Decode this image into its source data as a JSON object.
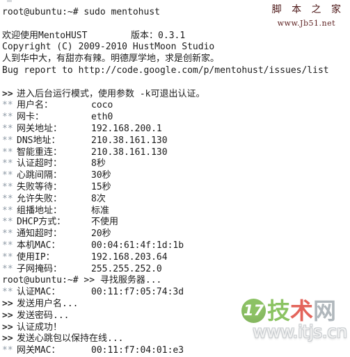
{
  "terminal": {
    "background_color": "#ffffff",
    "text_color": "#1a1a1a",
    "marker_color": "#8e9aa6",
    "lines": [
      {
        "type": "prompt",
        "text": "root@ubuntu:~# sudo mentohust"
      },
      {
        "type": "blank",
        "text": ""
      },
      {
        "type": "plain",
        "text": "欢迎使用MentoHUST        版本：0.3.1"
      },
      {
        "type": "plain",
        "text": "Copyright (C) 2009-2010 HustMoon Studio"
      },
      {
        "type": "plain",
        "text": "人到华中大，有甜亦有辣。明德厚学地，求是创新家。"
      },
      {
        "type": "plain",
        "text": "Bug report to http://code.google.com/p/mentohust/issues/list"
      },
      {
        "type": "blank",
        "text": ""
      },
      {
        "type": "arrow",
        "prefix": ">>",
        "text": "进入后台运行模式，使用参数 -k可退出认证。"
      },
      {
        "type": "kv",
        "prefix": "**",
        "label": "用户名：",
        "value": "coco"
      },
      {
        "type": "kv",
        "prefix": "**",
        "label": "网卡：",
        "value": "eth0"
      },
      {
        "type": "kv",
        "prefix": "**",
        "label": "网关地址：",
        "value": "192.168.200.1"
      },
      {
        "type": "kv",
        "prefix": "**",
        "label": "DNS地址：",
        "value": "210.38.161.130"
      },
      {
        "type": "kv",
        "prefix": "**",
        "label": "智能重连：",
        "value": "210.38.161.130"
      },
      {
        "type": "kv",
        "prefix": "**",
        "label": "认证超时：",
        "value": "8秒"
      },
      {
        "type": "kv",
        "prefix": "**",
        "label": "心跳间隔：",
        "value": "30秒"
      },
      {
        "type": "kv",
        "prefix": "**",
        "label": "失败等待：",
        "value": "15秒"
      },
      {
        "type": "kv",
        "prefix": "**",
        "label": "允许失败：",
        "value": "8次"
      },
      {
        "type": "kv",
        "prefix": "**",
        "label": "组播地址：",
        "value": "标准"
      },
      {
        "type": "kv",
        "prefix": "**",
        "label": "DHCP方式：",
        "value": "不使用"
      },
      {
        "type": "kv",
        "prefix": "**",
        "label": "通知超时：",
        "value": "20秒"
      },
      {
        "type": "kv",
        "prefix": "**",
        "label": "本机MAC：",
        "value": "00:04:61:4f:1d:1b"
      },
      {
        "type": "kv",
        "prefix": "**",
        "label": "使用IP：",
        "value": "192.168.203.64"
      },
      {
        "type": "kv",
        "prefix": "**",
        "label": "子网掩码：",
        "value": "255.255.252.0"
      },
      {
        "type": "prompt",
        "text": "root@ubuntu:~# >> 寻找服务器..."
      },
      {
        "type": "kv",
        "prefix": "**",
        "label": "认证MAC：",
        "value": "00:11:f7:05:74:3d"
      },
      {
        "type": "arrow",
        "prefix": ">>",
        "text": "发送用户名..."
      },
      {
        "type": "arrow",
        "prefix": ">>",
        "text": "发送密码..."
      },
      {
        "type": "arrow",
        "prefix": ">>",
        "text": "认证成功！"
      },
      {
        "type": "arrow",
        "prefix": ">>",
        "text": "发送心跳包以保持在线..."
      },
      {
        "type": "kv",
        "prefix": "**",
        "label": "网关MAC：",
        "value": "00:11:f7:04:01:e3"
      }
    ]
  },
  "watermark_top_right": {
    "brand_cn": "脚 本 之 家",
    "url": "www.Jb51.net",
    "color": "#5c1f1f"
  },
  "watermark_bottom_right": {
    "badge_text": "17",
    "brand_char_1": "技",
    "brand_char_2": "术",
    "brand_char_3": "网",
    "url": "www.itjs.cn",
    "badge_color": "#79b84a",
    "char_1_color": "#7fbd52",
    "char_2_color": "#e0544a",
    "char_3_color": "#a8b0b5",
    "url_color": "#f2f2f2"
  }
}
